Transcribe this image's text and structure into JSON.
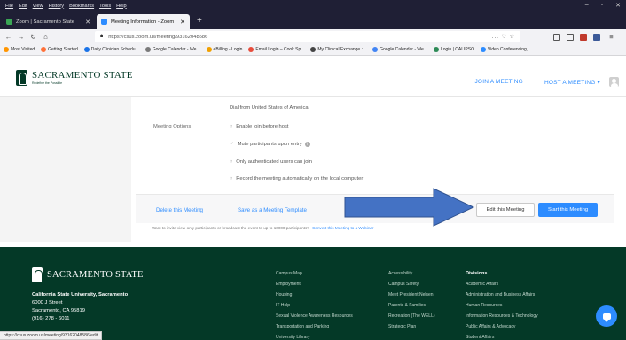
{
  "browser": {
    "menu": [
      "File",
      "Edit",
      "View",
      "History",
      "Bookmarks",
      "Tools",
      "Help"
    ],
    "tabs": [
      {
        "title": "Zoom | Sacramento State",
        "active": false,
        "favicon_color": "#3aa655"
      },
      {
        "title": "Meeting Information - Zoom",
        "active": true,
        "favicon_color": "#2d8cff"
      }
    ],
    "new_tab": "+",
    "url": "https://csus.zoom.us/meeting/93162048586",
    "url_right": "... ♡ ☆",
    "bookmarks": [
      {
        "label": "Most Visited",
        "color": "#ff9500"
      },
      {
        "label": "Getting Started",
        "color": "#ff7139"
      },
      {
        "label": "Daily Clinician Schedu...",
        "color": "#1a73e8"
      },
      {
        "label": "Google Calendar - We...",
        "color": "#7a7a7a"
      },
      {
        "label": "eBilling - Login",
        "color": "#f0a000"
      },
      {
        "label": "Email Login – Cook Sp...",
        "color": "#e74c3c"
      },
      {
        "label": "My Clinical Exchange :...",
        "color": "#444"
      },
      {
        "label": "Google Calendar - We...",
        "color": "#4285f4"
      },
      {
        "label": "Login | CALIPSO",
        "color": "#2e8b57"
      },
      {
        "label": "Video Conferencing, ...",
        "color": "#2d8cff"
      }
    ]
  },
  "header": {
    "logo_text": "SACRAMENTO STATE",
    "logo_tag": "Redefine the Possible",
    "nav": [
      "JOIN A MEETING",
      "HOST A MEETING ▾"
    ]
  },
  "meeting": {
    "dial_in": "Dial from United States of America",
    "options_label": "Meeting Options",
    "options": [
      {
        "label": "Enable join before host",
        "checked": false
      },
      {
        "label": "Mute participants upon entry",
        "checked": true,
        "info": "i"
      },
      {
        "label": "Only authenticated users can join",
        "checked": false
      },
      {
        "label": "Record the meeting automatically on the local computer",
        "checked": false
      }
    ],
    "delete_label": "Delete this Meeting",
    "template_label": "Save as a Meeting Template",
    "edit_label": "Edit this Meeting",
    "start_label": "Start this Meeting",
    "invite_text": "Want to invite view-only participants or broadcast the event to up to 10000 participants?",
    "invite_link": "Convert this Meeting to a Webinar"
  },
  "footer": {
    "logo_text": "SACRAMENTO STATE",
    "address_name": "California State University, Sacramento",
    "address_lines": [
      "6000 J Street",
      "Sacramento, CA 95819",
      "(916) 278 - 6011"
    ],
    "col1": [
      "Campus Map",
      "Employment",
      "Housing",
      "IT Help",
      "Sexual Violence Awareness Resources",
      "Transportation and Parking",
      "University Library"
    ],
    "col2": [
      "Accessibility",
      "Campus Safety",
      "Meet President Nelsen",
      "Parents & Families",
      "Recreation (The WELL)",
      "Strategic Plan"
    ],
    "col3_heading": "Divisions",
    "col3": [
      "Academic Affairs",
      "Administration and Business Affairs",
      "Human Resources",
      "Information Resources & Technology",
      "Public Affairs & Advocacy",
      "Student Affairs"
    ]
  },
  "status_bar": "https://csus.zoom.us/meeting/93162048586/edit",
  "colors": {
    "brand_green": "#043927",
    "zoom_blue": "#2d8cff",
    "arrow_blue": "#4472c4"
  }
}
